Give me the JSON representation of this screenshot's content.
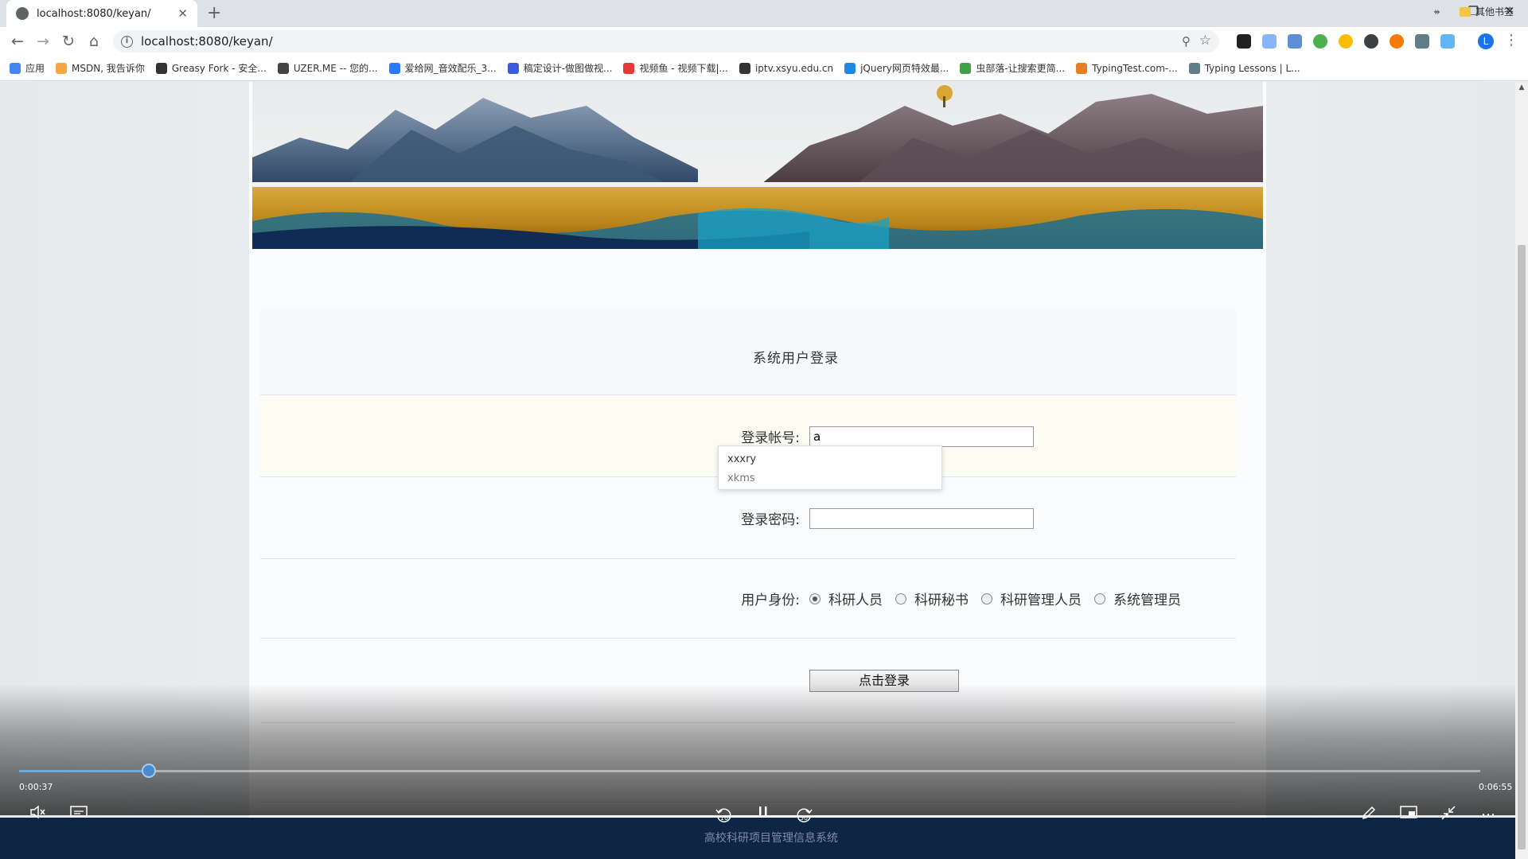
{
  "browser": {
    "tab_title": "localhost:8080/keyan/",
    "url": "localhost:8080/keyan/",
    "avatar_letter": "L",
    "bookmarks": [
      {
        "label": "应用",
        "color": "#4285f4"
      },
      {
        "label": "MSDN, 我告诉你",
        "color": "#f4a742"
      },
      {
        "label": "Greasy Fork - 安全...",
        "color": "#333333"
      },
      {
        "label": "UZER.ME -- 您的...",
        "color": "#444444"
      },
      {
        "label": "爱给网_音效配乐_3...",
        "color": "#2979ff"
      },
      {
        "label": "稿定设计-做图做视...",
        "color": "#3b5bdb"
      },
      {
        "label": "视频鱼 - 视频下载|...",
        "color": "#e53935"
      },
      {
        "label": "iptv.xsyu.edu.cn",
        "color": "#333333"
      },
      {
        "label": "jQuery网页特效最...",
        "color": "#1e88e5"
      },
      {
        "label": "虫部落-让搜索更简...",
        "color": "#43a047"
      },
      {
        "label": "TypingTest.com-...",
        "color": "#e67e22"
      },
      {
        "label": "Typing Lessons | L...",
        "color": "#607d8b"
      }
    ],
    "bookmarks_more": "»",
    "other_bookmarks": "其他书签"
  },
  "form": {
    "title": "系统用户登录",
    "account_label": "登录帐号:",
    "account_value": "a",
    "autocomplete": [
      "xxxry",
      "xkms"
    ],
    "password_label": "登录密码:",
    "password_value": "",
    "role_label": "用户身份:",
    "roles": [
      "科研人员",
      "科研秘书",
      "科研管理人员",
      "系统管理员"
    ],
    "selected_role": 0,
    "submit_label": "点击登录"
  },
  "footer": {
    "text": "高校科研项目管理信息系统"
  },
  "video": {
    "current_time": "0:00:37",
    "total_time": "0:06:55",
    "progress_fraction": 0.089,
    "rewind_seconds": "10",
    "forward_seconds": "30"
  },
  "colors": {
    "footer_bg": "#0f2544",
    "progress": "#4a8bd0"
  }
}
